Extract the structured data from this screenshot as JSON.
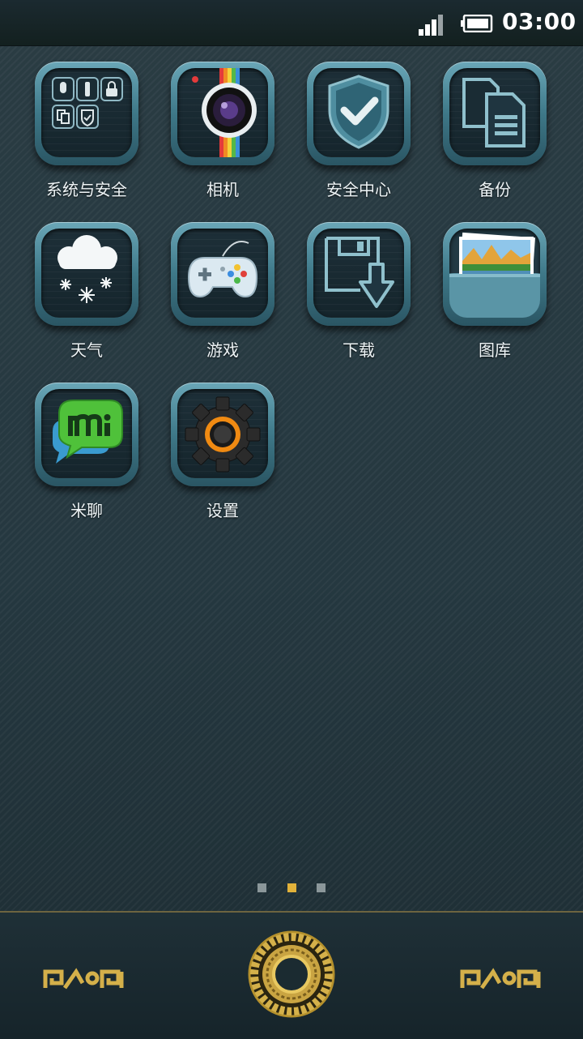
{
  "status_bar": {
    "time": "03:00",
    "signal_icon": "signal-icon",
    "battery_icon": "battery-icon"
  },
  "apps": [
    {
      "label": "系统与安全",
      "icon": "system-security-icon"
    },
    {
      "label": "相机",
      "icon": "camera-icon"
    },
    {
      "label": "安全中心",
      "icon": "shield-check-icon"
    },
    {
      "label": "备份",
      "icon": "backup-documents-icon"
    },
    {
      "label": "天气",
      "icon": "weather-snow-icon"
    },
    {
      "label": "游戏",
      "icon": "gamepad-icon"
    },
    {
      "label": "下载",
      "icon": "download-icon"
    },
    {
      "label": "图库",
      "icon": "gallery-icon"
    },
    {
      "label": "米聊",
      "icon": "mi-chat-icon"
    },
    {
      "label": "设置",
      "icon": "settings-gear-icon"
    }
  ],
  "page_indicator": {
    "pages": 3,
    "current": 2,
    "active_color": "#e2b23a",
    "inactive_color": "#8b979a"
  },
  "dock": {
    "left_icon": "ornament-left-icon",
    "center_icon": "ornament-home-ring-icon",
    "right_icon": "ornament-right-icon",
    "accent_color": "#d4b04a"
  }
}
